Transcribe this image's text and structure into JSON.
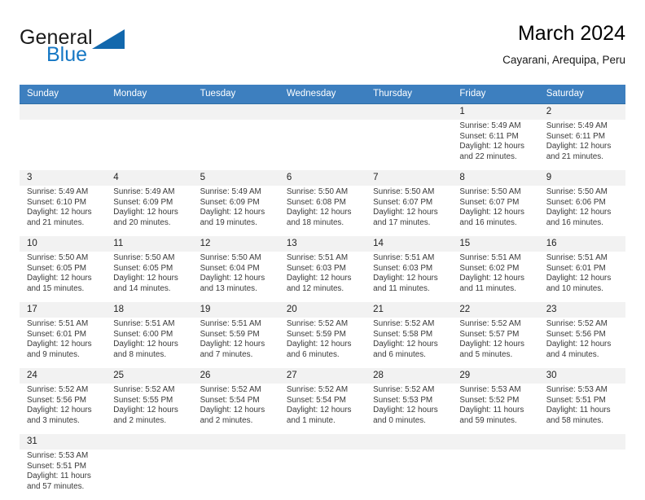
{
  "brand": {
    "name_top": "General",
    "name_bottom": "Blue",
    "accent_color": "#1268ad"
  },
  "header": {
    "title": "March 2024",
    "subtitle": "Cayarani, Arequipa, Peru"
  },
  "theme": {
    "header_bg": "#3d7fbf",
    "header_text": "#ffffff",
    "numstrip_bg": "#f2f2f2",
    "row_divider": "#2e6da4",
    "body_text": "#3a3a3a"
  },
  "calendar": {
    "weekday_headers": [
      "Sunday",
      "Monday",
      "Tuesday",
      "Wednesday",
      "Thursday",
      "Friday",
      "Saturday"
    ],
    "weeks": [
      [
        {
          "day": "",
          "lines": []
        },
        {
          "day": "",
          "lines": []
        },
        {
          "day": "",
          "lines": []
        },
        {
          "day": "",
          "lines": []
        },
        {
          "day": "",
          "lines": []
        },
        {
          "day": "1",
          "lines": [
            "Sunrise: 5:49 AM",
            "Sunset: 6:11 PM",
            "Daylight: 12 hours",
            "and 22 minutes."
          ]
        },
        {
          "day": "2",
          "lines": [
            "Sunrise: 5:49 AM",
            "Sunset: 6:11 PM",
            "Daylight: 12 hours",
            "and 21 minutes."
          ]
        }
      ],
      [
        {
          "day": "3",
          "lines": [
            "Sunrise: 5:49 AM",
            "Sunset: 6:10 PM",
            "Daylight: 12 hours",
            "and 21 minutes."
          ]
        },
        {
          "day": "4",
          "lines": [
            "Sunrise: 5:49 AM",
            "Sunset: 6:09 PM",
            "Daylight: 12 hours",
            "and 20 minutes."
          ]
        },
        {
          "day": "5",
          "lines": [
            "Sunrise: 5:49 AM",
            "Sunset: 6:09 PM",
            "Daylight: 12 hours",
            "and 19 minutes."
          ]
        },
        {
          "day": "6",
          "lines": [
            "Sunrise: 5:50 AM",
            "Sunset: 6:08 PM",
            "Daylight: 12 hours",
            "and 18 minutes."
          ]
        },
        {
          "day": "7",
          "lines": [
            "Sunrise: 5:50 AM",
            "Sunset: 6:07 PM",
            "Daylight: 12 hours",
            "and 17 minutes."
          ]
        },
        {
          "day": "8",
          "lines": [
            "Sunrise: 5:50 AM",
            "Sunset: 6:07 PM",
            "Daylight: 12 hours",
            "and 16 minutes."
          ]
        },
        {
          "day": "9",
          "lines": [
            "Sunrise: 5:50 AM",
            "Sunset: 6:06 PM",
            "Daylight: 12 hours",
            "and 16 minutes."
          ]
        }
      ],
      [
        {
          "day": "10",
          "lines": [
            "Sunrise: 5:50 AM",
            "Sunset: 6:05 PM",
            "Daylight: 12 hours",
            "and 15 minutes."
          ]
        },
        {
          "day": "11",
          "lines": [
            "Sunrise: 5:50 AM",
            "Sunset: 6:05 PM",
            "Daylight: 12 hours",
            "and 14 minutes."
          ]
        },
        {
          "day": "12",
          "lines": [
            "Sunrise: 5:50 AM",
            "Sunset: 6:04 PM",
            "Daylight: 12 hours",
            "and 13 minutes."
          ]
        },
        {
          "day": "13",
          "lines": [
            "Sunrise: 5:51 AM",
            "Sunset: 6:03 PM",
            "Daylight: 12 hours",
            "and 12 minutes."
          ]
        },
        {
          "day": "14",
          "lines": [
            "Sunrise: 5:51 AM",
            "Sunset: 6:03 PM",
            "Daylight: 12 hours",
            "and 11 minutes."
          ]
        },
        {
          "day": "15",
          "lines": [
            "Sunrise: 5:51 AM",
            "Sunset: 6:02 PM",
            "Daylight: 12 hours",
            "and 11 minutes."
          ]
        },
        {
          "day": "16",
          "lines": [
            "Sunrise: 5:51 AM",
            "Sunset: 6:01 PM",
            "Daylight: 12 hours",
            "and 10 minutes."
          ]
        }
      ],
      [
        {
          "day": "17",
          "lines": [
            "Sunrise: 5:51 AM",
            "Sunset: 6:01 PM",
            "Daylight: 12 hours",
            "and 9 minutes."
          ]
        },
        {
          "day": "18",
          "lines": [
            "Sunrise: 5:51 AM",
            "Sunset: 6:00 PM",
            "Daylight: 12 hours",
            "and 8 minutes."
          ]
        },
        {
          "day": "19",
          "lines": [
            "Sunrise: 5:51 AM",
            "Sunset: 5:59 PM",
            "Daylight: 12 hours",
            "and 7 minutes."
          ]
        },
        {
          "day": "20",
          "lines": [
            "Sunrise: 5:52 AM",
            "Sunset: 5:59 PM",
            "Daylight: 12 hours",
            "and 6 minutes."
          ]
        },
        {
          "day": "21",
          "lines": [
            "Sunrise: 5:52 AM",
            "Sunset: 5:58 PM",
            "Daylight: 12 hours",
            "and 6 minutes."
          ]
        },
        {
          "day": "22",
          "lines": [
            "Sunrise: 5:52 AM",
            "Sunset: 5:57 PM",
            "Daylight: 12 hours",
            "and 5 minutes."
          ]
        },
        {
          "day": "23",
          "lines": [
            "Sunrise: 5:52 AM",
            "Sunset: 5:56 PM",
            "Daylight: 12 hours",
            "and 4 minutes."
          ]
        }
      ],
      [
        {
          "day": "24",
          "lines": [
            "Sunrise: 5:52 AM",
            "Sunset: 5:56 PM",
            "Daylight: 12 hours",
            "and 3 minutes."
          ]
        },
        {
          "day": "25",
          "lines": [
            "Sunrise: 5:52 AM",
            "Sunset: 5:55 PM",
            "Daylight: 12 hours",
            "and 2 minutes."
          ]
        },
        {
          "day": "26",
          "lines": [
            "Sunrise: 5:52 AM",
            "Sunset: 5:54 PM",
            "Daylight: 12 hours",
            "and 2 minutes."
          ]
        },
        {
          "day": "27",
          "lines": [
            "Sunrise: 5:52 AM",
            "Sunset: 5:54 PM",
            "Daylight: 12 hours",
            "and 1 minute."
          ]
        },
        {
          "day": "28",
          "lines": [
            "Sunrise: 5:52 AM",
            "Sunset: 5:53 PM",
            "Daylight: 12 hours",
            "and 0 minutes."
          ]
        },
        {
          "day": "29",
          "lines": [
            "Sunrise: 5:53 AM",
            "Sunset: 5:52 PM",
            "Daylight: 11 hours",
            "and 59 minutes."
          ]
        },
        {
          "day": "30",
          "lines": [
            "Sunrise: 5:53 AM",
            "Sunset: 5:51 PM",
            "Daylight: 11 hours",
            "and 58 minutes."
          ]
        }
      ],
      [
        {
          "day": "31",
          "lines": [
            "Sunrise: 5:53 AM",
            "Sunset: 5:51 PM",
            "Daylight: 11 hours",
            "and 57 minutes."
          ]
        },
        {
          "day": "",
          "lines": []
        },
        {
          "day": "",
          "lines": []
        },
        {
          "day": "",
          "lines": []
        },
        {
          "day": "",
          "lines": []
        },
        {
          "day": "",
          "lines": []
        },
        {
          "day": "",
          "lines": []
        }
      ]
    ]
  }
}
